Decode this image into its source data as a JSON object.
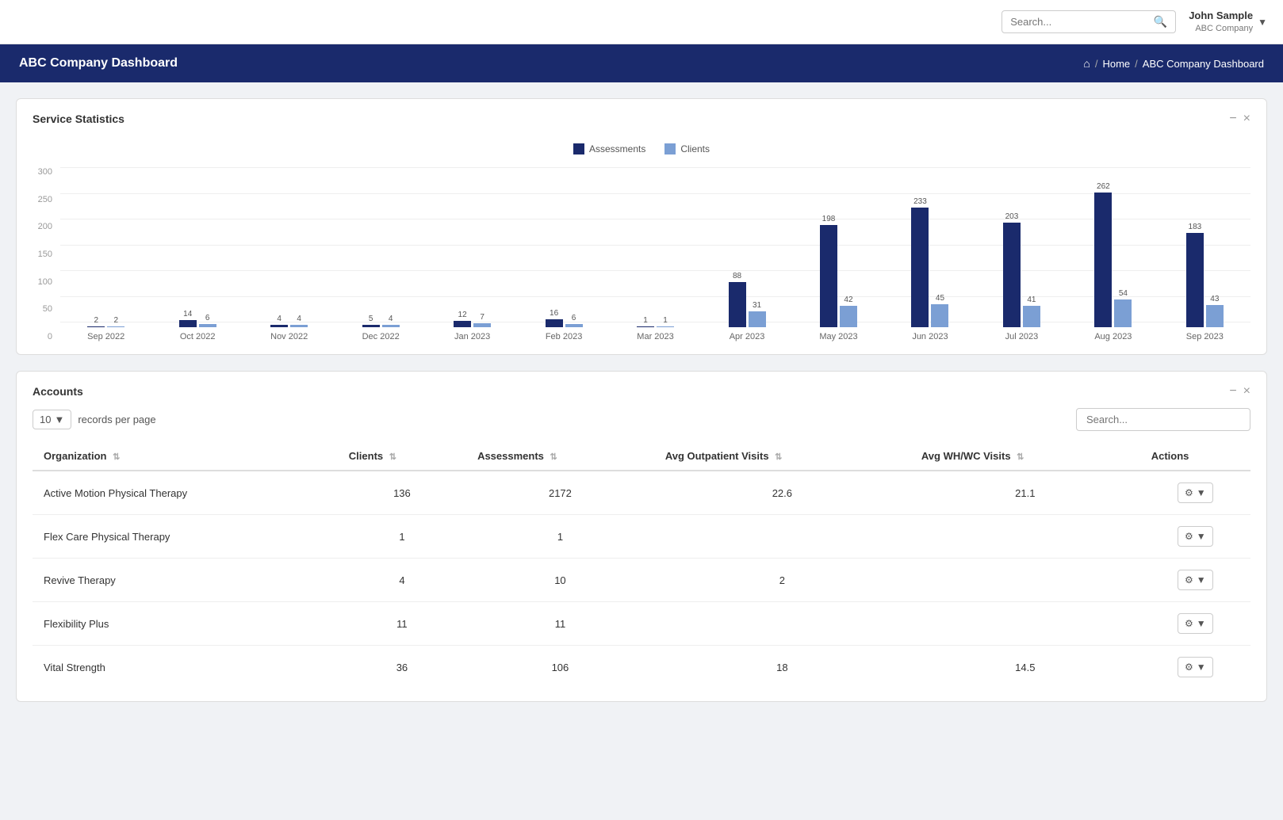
{
  "topNav": {
    "search": {
      "placeholder": "Search...",
      "value": ""
    },
    "user": {
      "name": "John Sample",
      "company": "ABC Company"
    }
  },
  "headerBar": {
    "title": "ABC Company Dashboard",
    "breadcrumb": {
      "home": "Home",
      "current": "ABC Company Dashboard"
    }
  },
  "serviceStats": {
    "title": "Service Statistics",
    "legend": {
      "assessments": "Assessments",
      "clients": "Clients"
    },
    "yAxis": [
      "0",
      "50",
      "100",
      "150",
      "200",
      "250",
      "300"
    ],
    "months": [
      {
        "label": "Sep 2022",
        "assessments": 2,
        "clients": 2
      },
      {
        "label": "Oct 2022",
        "assessments": 14,
        "clients": 6
      },
      {
        "label": "Nov 2022",
        "assessments": 4,
        "clients": 4
      },
      {
        "label": "Dec 2022",
        "assessments": 5,
        "clients": 4
      },
      {
        "label": "Jan 2023",
        "assessments": 12,
        "clients": 7
      },
      {
        "label": "Feb 2023",
        "assessments": 16,
        "clients": 6
      },
      {
        "label": "Mar 2023",
        "assessments": 1,
        "clients": 1
      },
      {
        "label": "Apr 2023",
        "assessments": 88,
        "clients": 31
      },
      {
        "label": "May 2023",
        "assessments": 198,
        "clients": 42
      },
      {
        "label": "Jun 2023",
        "assessments": 233,
        "clients": 45
      },
      {
        "label": "Jul 2023",
        "assessments": 203,
        "clients": 41
      },
      {
        "label": "Aug 2023",
        "assessments": 262,
        "clients": 54
      },
      {
        "label": "Sep 2023",
        "assessments": 183,
        "clients": 43
      }
    ],
    "maxValue": 300
  },
  "accounts": {
    "title": "Accounts",
    "recordsPerPage": "10",
    "recordsLabel": "records per page",
    "searchPlaceholder": "Search...",
    "columns": [
      {
        "label": "Organization",
        "key": "organization",
        "sortable": true
      },
      {
        "label": "Clients",
        "key": "clients",
        "sortable": true
      },
      {
        "label": "Assessments",
        "key": "assessments",
        "sortable": true
      },
      {
        "label": "Avg Outpatient Visits",
        "key": "avgOutpatient",
        "sortable": true
      },
      {
        "label": "Avg WH/WC Visits",
        "key": "avgWH",
        "sortable": true
      },
      {
        "label": "Actions",
        "key": "actions",
        "sortable": false
      }
    ],
    "rows": [
      {
        "organization": "Active Motion Physical Therapy",
        "clients": "136",
        "assessments": "2172",
        "avgOutpatient": "22.6",
        "avgWH": "21.1"
      },
      {
        "organization": "Flex Care Physical Therapy",
        "clients": "1",
        "assessments": "1",
        "avgOutpatient": "",
        "avgWH": ""
      },
      {
        "organization": "Revive Therapy",
        "clients": "4",
        "assessments": "10",
        "avgOutpatient": "2",
        "avgWH": ""
      },
      {
        "organization": "Flexibility Plus",
        "clients": "11",
        "assessments": "11",
        "avgOutpatient": "",
        "avgWH": ""
      },
      {
        "organization": "Vital Strength",
        "clients": "36",
        "assessments": "106",
        "avgOutpatient": "18",
        "avgWH": "14.5"
      }
    ]
  }
}
